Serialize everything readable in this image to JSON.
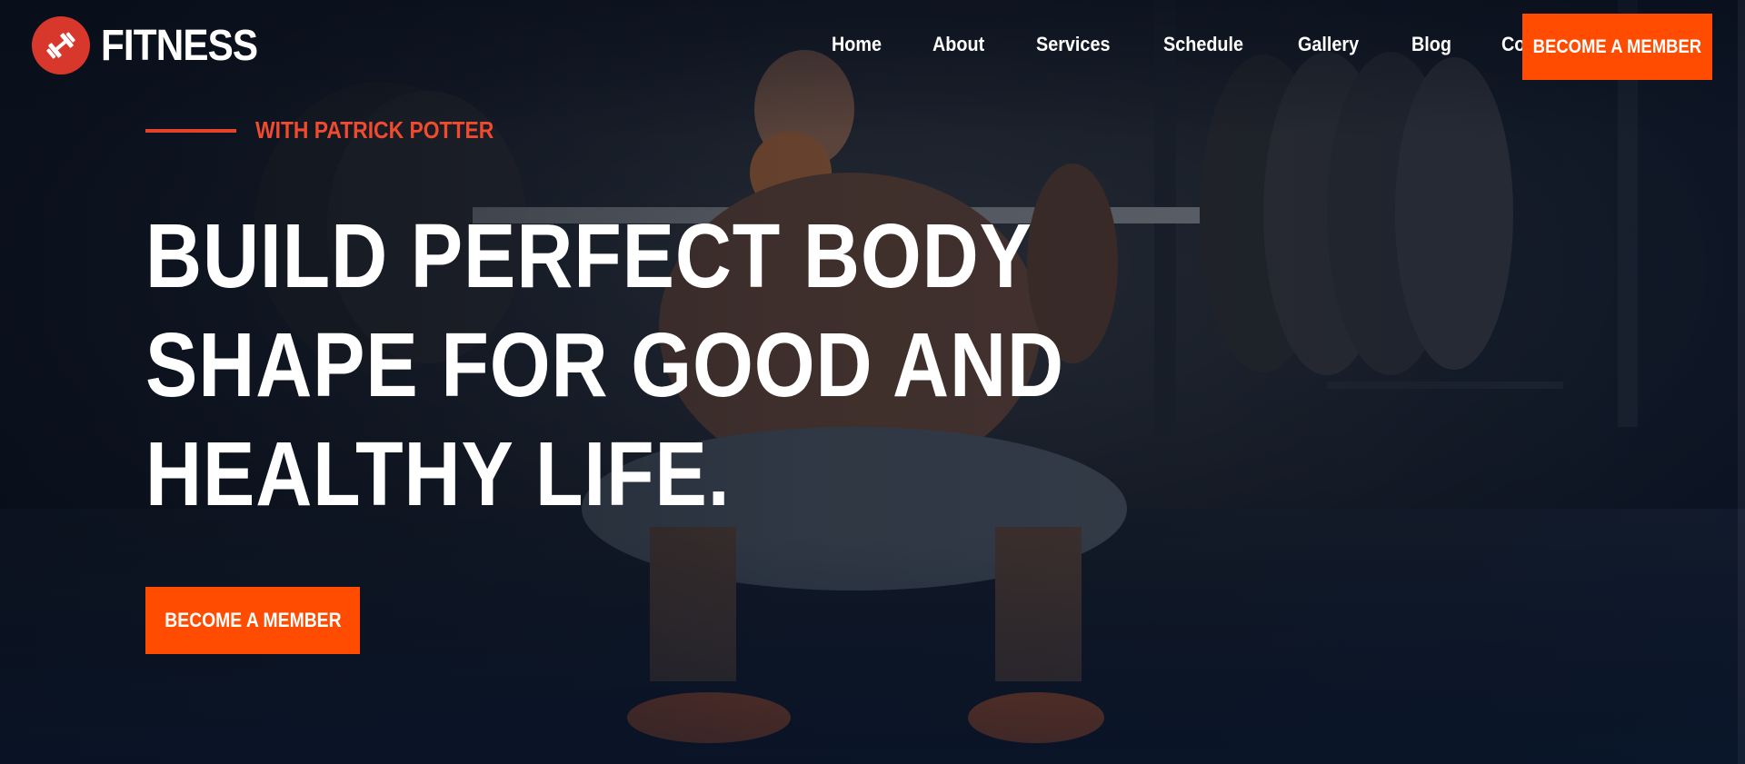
{
  "brand": {
    "name": "FITNESS",
    "icon": "dumbbell-icon",
    "color": "#d8382c"
  },
  "nav": {
    "items": [
      "Home",
      "About",
      "Services",
      "Schedule",
      "Gallery",
      "Blog",
      "Contact"
    ]
  },
  "header": {
    "cta_label": "BECOME A MEMBER"
  },
  "hero": {
    "subtitle": "WITH PATRICK POTTER",
    "headline": [
      "BUILD PERFECT BODY",
      "SHAPE FOR GOOD AND",
      "HEALTHY LIFE."
    ],
    "cta_label": "BECOME A MEMBER",
    "background": "weightlifter-squat-photo"
  },
  "colors": {
    "accent": "#ff4c00",
    "subtitle": "#f04a2f",
    "background": "#0e1622"
  }
}
